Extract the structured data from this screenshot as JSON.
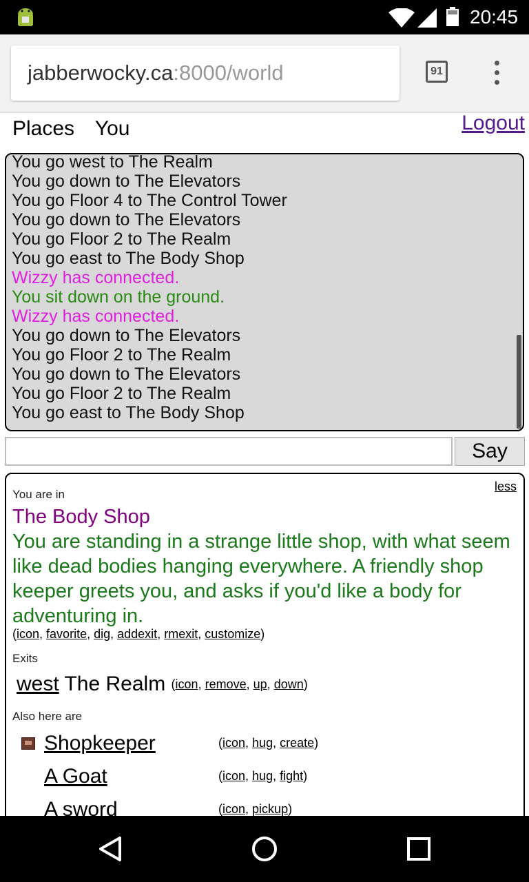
{
  "status_bar": {
    "time": "20:45",
    "icons": [
      "android-icon",
      "wifi-icon",
      "signal-icon",
      "battery-icon"
    ]
  },
  "browser": {
    "url_host": "jabberwocky.ca",
    "url_path": ":8000/world",
    "tab_count": "91"
  },
  "nav": {
    "places": "Places",
    "you": "You",
    "logout": "Logout"
  },
  "log": {
    "lines": [
      {
        "text": "You go west to The Realm",
        "color": "#111111"
      },
      {
        "text": "You go down to The Elevators",
        "color": "#111111"
      },
      {
        "text": "You go Floor 4 to The Control Tower",
        "color": "#111111"
      },
      {
        "text": "You go down to The Elevators",
        "color": "#111111"
      },
      {
        "text": "You go Floor 2 to The Realm",
        "color": "#111111"
      },
      {
        "text": "You go east to The Body Shop",
        "color": "#111111"
      },
      {
        "text": "Wizzy has connected.",
        "color": "#e01ee0"
      },
      {
        "text": "You sit down on the ground.",
        "color": "#2a8a14"
      },
      {
        "text": "Wizzy has connected.",
        "color": "#e01ee0"
      },
      {
        "text": "You go down to The Elevators",
        "color": "#111111"
      },
      {
        "text": "You go Floor 2 to The Realm",
        "color": "#111111"
      },
      {
        "text": "You go down to The Elevators",
        "color": "#111111"
      },
      {
        "text": "You go Floor 2 to The Realm",
        "color": "#111111"
      },
      {
        "text": "You go east to The Body Shop",
        "color": "#111111"
      }
    ]
  },
  "say": {
    "value": "",
    "button": "Say"
  },
  "room": {
    "less": "less",
    "you_are_in": "You are in",
    "name": "The Body Shop",
    "description": "You are standing in a strange little shop, with what seem like dead bodies hanging everywhere. A friendly shop keeper greets you, and asks if you'd like a body for adventuring in.",
    "actions": {
      "icon": "icon",
      "favorite": "favorite",
      "dig": "dig",
      "addexit": "addexit",
      "rmexit": "rmexit",
      "customize": "customize"
    },
    "exits_label": "Exits",
    "exit": {
      "dir": "west",
      "dest": "The Realm",
      "icon": "icon",
      "remove": "remove",
      "up": "up",
      "down": "down"
    },
    "also_label": "Also here are",
    "things": [
      {
        "name": "Shopkeeper",
        "a1": "icon",
        "a2": "hug",
        "a3": "create"
      },
      {
        "name": "A Goat",
        "a1": "icon",
        "a2": "hug",
        "a3": "fight"
      },
      {
        "name": "A sword",
        "a1": "icon",
        "a2": "pickup"
      }
    ]
  }
}
